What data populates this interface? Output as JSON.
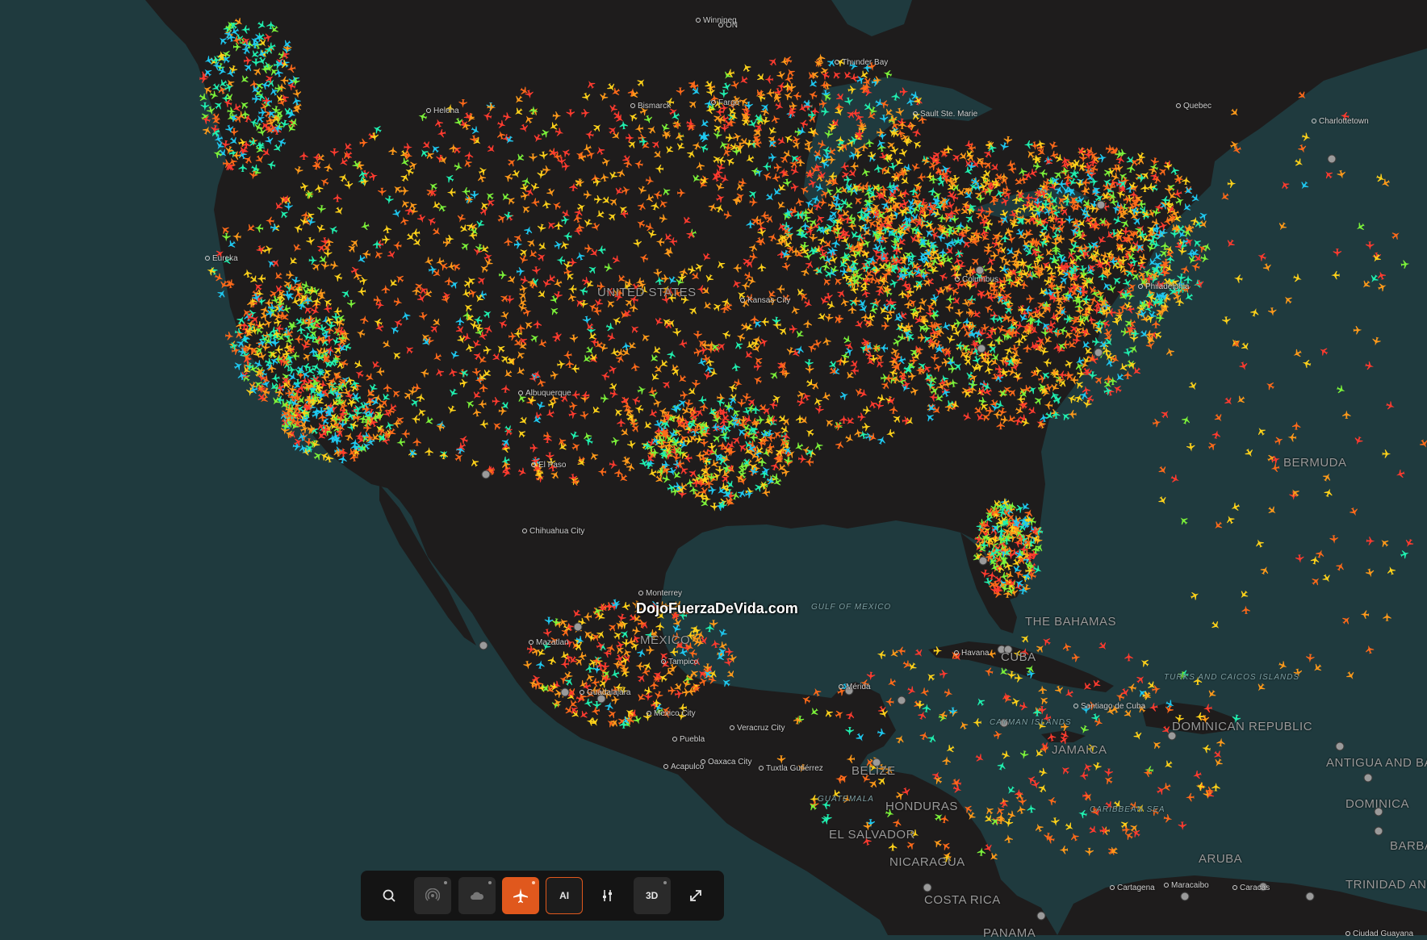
{
  "map": {
    "ocean_color": "#1f3a3e",
    "land_color": "#1e1c1c",
    "traffic_colors": [
      "#ff3b2f",
      "#ff6a1a",
      "#ff9a1a",
      "#ffd21a",
      "#7cf23a",
      "#20f0b0",
      "#1fc8f0"
    ],
    "labels": [
      {
        "text": "ON",
        "type": "region"
      },
      {
        "text": "Winnipeg",
        "type": "city"
      },
      {
        "text": "Thunder Bay",
        "type": "city"
      },
      {
        "text": "Bismarck",
        "type": "city"
      },
      {
        "text": "Fargo",
        "type": "city"
      },
      {
        "text": "Helena",
        "type": "city"
      },
      {
        "text": "Eureka",
        "type": "city"
      },
      {
        "text": "Sault Ste. Marie",
        "type": "city"
      },
      {
        "text": "Quebec",
        "type": "city"
      },
      {
        "text": "Charlottetown",
        "type": "city"
      },
      {
        "text": "UNITED STATES",
        "type": "country"
      },
      {
        "text": "Kansas City",
        "type": "city"
      },
      {
        "text": "Columbus",
        "type": "city"
      },
      {
        "text": "Philadelphia",
        "type": "city"
      },
      {
        "text": "Albuquerque",
        "type": "city"
      },
      {
        "text": "El Paso",
        "type": "city"
      },
      {
        "text": "Chihuahua City",
        "type": "city"
      },
      {
        "text": "Monterrey",
        "type": "city"
      },
      {
        "text": "GULF OF MEXICO",
        "type": "sea"
      },
      {
        "text": "THE BAHAMAS",
        "type": "country"
      },
      {
        "text": "BERMUDA",
        "type": "country"
      },
      {
        "text": "Mazatlan",
        "type": "city"
      },
      {
        "text": "MEXICO",
        "type": "country"
      },
      {
        "text": "Tampico",
        "type": "city"
      },
      {
        "text": "Havana",
        "type": "city"
      },
      {
        "text": "CUBA",
        "type": "country"
      },
      {
        "text": "Guadalajara",
        "type": "city"
      },
      {
        "text": "Mérida",
        "type": "city"
      },
      {
        "text": "Mexico City",
        "type": "city"
      },
      {
        "text": "Veracruz City",
        "type": "city"
      },
      {
        "text": "Puebla",
        "type": "city"
      },
      {
        "text": "Acapulco",
        "type": "city"
      },
      {
        "text": "Oaxaca City",
        "type": "city"
      },
      {
        "text": "Tuxtla Gutiérrez",
        "type": "city"
      },
      {
        "text": "BELIZE",
        "type": "country"
      },
      {
        "text": "CAYMAN ISLANDS",
        "type": "sea"
      },
      {
        "text": "Santiago de Cuba",
        "type": "city"
      },
      {
        "text": "TURKS AND CAICOS ISLANDS",
        "type": "sea"
      },
      {
        "text": "DOMINICAN REPUBLIC",
        "type": "country"
      },
      {
        "text": "JAMAICA",
        "type": "country"
      },
      {
        "text": "ANTIGUA AND BARBUDA",
        "type": "country"
      },
      {
        "text": "GUATEMALA",
        "type": "sea"
      },
      {
        "text": "HONDURAS",
        "type": "country"
      },
      {
        "text": "CARIBBEAN SEA",
        "type": "sea"
      },
      {
        "text": "DOMINICA",
        "type": "country"
      },
      {
        "text": "EL SALVADOR",
        "type": "country"
      },
      {
        "text": "NICARAGUA",
        "type": "country"
      },
      {
        "text": "ARUBA",
        "type": "country"
      },
      {
        "text": "BARBADOS",
        "type": "country"
      },
      {
        "text": "Cartagena",
        "type": "city"
      },
      {
        "text": "Maracaibo",
        "type": "city"
      },
      {
        "text": "Caracas",
        "type": "city"
      },
      {
        "text": "TRINIDAD AND TOBAGO",
        "type": "country"
      },
      {
        "text": "COSTA RICA",
        "type": "country"
      },
      {
        "text": "PANAMA",
        "type": "country"
      },
      {
        "text": "Ciudad Guayana",
        "type": "city"
      }
    ]
  },
  "watermark": "DojoFuerzaDeVida.com",
  "toolbar": {
    "search_icon": "search-icon",
    "radar_icon": "radar-icon",
    "weather_icon": "cloud-icon",
    "flights_icon": "airplane-icon",
    "ai_label": "AI",
    "filters_icon": "sliders-icon",
    "view3d_label": "3D",
    "fullscreen_icon": "expand-icon",
    "accent_color": "#e0581d"
  }
}
